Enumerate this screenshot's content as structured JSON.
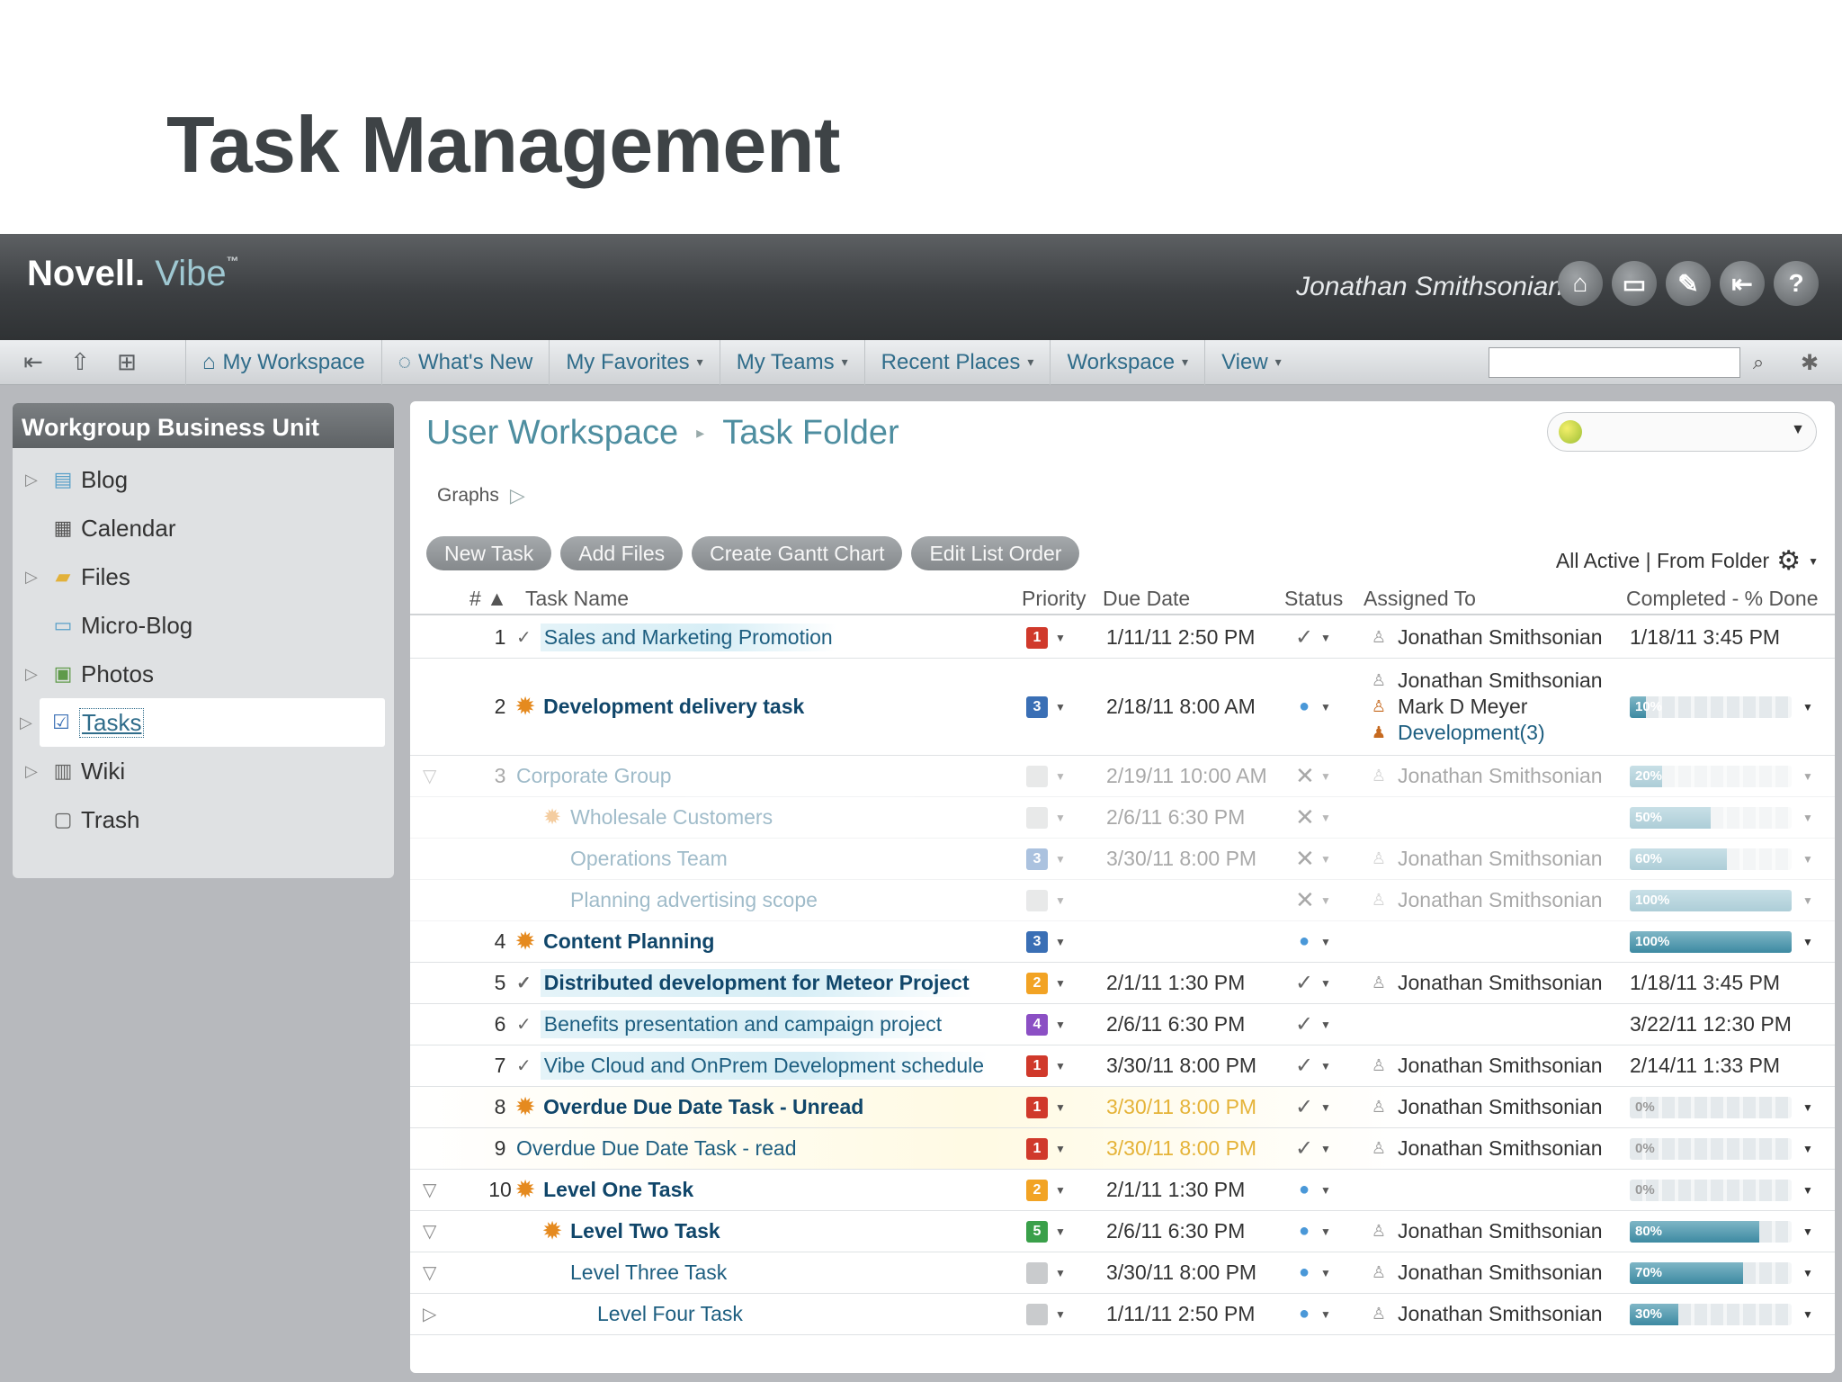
{
  "slide": {
    "title": "Task Management"
  },
  "header": {
    "brand": "Novell.",
    "product": "Vibe",
    "tm": "™",
    "user": "Jonathan Smithsonian",
    "icons": [
      "home-icon",
      "monitor-icon",
      "edit-icon",
      "logout-icon",
      "help-icon"
    ]
  },
  "nav": {
    "tool_icons": [
      "collapse-icon",
      "upload-icon",
      "tree-icon"
    ],
    "items": [
      {
        "label": "My Workspace",
        "icon": "workspace-icon",
        "arrow": false
      },
      {
        "label": "What's New",
        "icon": "whats-new-icon",
        "arrow": false
      },
      {
        "label": "My Favorites",
        "arrow": true
      },
      {
        "label": "My Teams",
        "arrow": true
      },
      {
        "label": "Recent Places",
        "arrow": true
      },
      {
        "label": "Workspace",
        "arrow": true
      },
      {
        "label": "View",
        "arrow": true
      }
    ],
    "search_value": ""
  },
  "sidebar": {
    "title": "Workgroup Business Unit",
    "items": [
      {
        "label": "Blog",
        "icon": "blog-icon",
        "expandable": true
      },
      {
        "label": "Calendar",
        "icon": "calendar-icon",
        "expandable": false
      },
      {
        "label": "Files",
        "icon": "folder-icon",
        "expandable": true
      },
      {
        "label": "Micro-Blog",
        "icon": "micro-blog-icon",
        "expandable": false
      },
      {
        "label": "Photos",
        "icon": "photos-icon",
        "expandable": true
      },
      {
        "label": "Tasks",
        "icon": "tasks-icon",
        "expandable": true,
        "active": true
      },
      {
        "label": "Wiki",
        "icon": "wiki-icon",
        "expandable": true
      },
      {
        "label": "Trash",
        "icon": "trash-icon",
        "expandable": false
      }
    ]
  },
  "main": {
    "breadcrumb": [
      "User Workspace",
      "Task Folder"
    ],
    "graphs_label": "Graphs",
    "buttons": [
      "New Task",
      "Add Files",
      "Create Gantt Chart",
      "Edit List Order"
    ],
    "filter_label": "All Active | From Folder",
    "columns": {
      "num": "# ▲",
      "name": "Task Name",
      "priority": "Priority",
      "due": "Due Date",
      "status": "Status",
      "assigned": "Assigned To",
      "completed": "Completed - % Done"
    },
    "colors": {
      "accent": "#4e8ea0",
      "link": "#1d5e80",
      "overdue": "#e5b338",
      "priority_1": "#d0392b",
      "priority_2": "#f2a324",
      "priority_3": "#3a6fb5",
      "priority_4": "#8b4fc4",
      "priority_5": "#3aa04a"
    },
    "rows": [
      {
        "num": "1",
        "name": "Sales and Marketing Promotion",
        "state": "check",
        "bold": false,
        "indent": 0,
        "toggle": "",
        "priority": "1",
        "due": "1/11/11 2:50 PM",
        "status": "check",
        "assigned": [
          {
            "name": "Jonathan Smithsonian",
            "type": "person"
          }
        ],
        "completed": "1/18/11 3:45 PM",
        "highlight": true
      },
      {
        "num": "2",
        "name": "Development delivery task",
        "state": "sun",
        "bold": true,
        "indent": 0,
        "toggle": "",
        "priority": "3",
        "due": "2/18/11 8:00 AM",
        "status": "progress",
        "assigned": [
          {
            "name": "Jonathan Smithsonian",
            "type": "person"
          },
          {
            "name": "Mark D Meyer",
            "type": "person2"
          },
          {
            "name": "Development(3)",
            "type": "group"
          }
        ],
        "percent": 10,
        "percent_label": "10%",
        "tall": true
      },
      {
        "num": "3",
        "name": "Corporate Group",
        "state": "",
        "bold": false,
        "indent": 0,
        "toggle": "open",
        "priority": "",
        "due": "2/19/11 10:00 AM",
        "status": "x",
        "assigned": [
          {
            "name": "Jonathan Smithsonian",
            "type": "person"
          }
        ],
        "percent": 20,
        "percent_label": "20%",
        "dim": true
      },
      {
        "num": "",
        "name": "Wholesale Customers",
        "state": "sun",
        "bold": false,
        "indent": 1,
        "toggle": "",
        "priority": "",
        "due": "2/6/11 6:30 PM",
        "status": "x",
        "assigned": [],
        "percent": 50,
        "percent_label": "50%",
        "dim": true
      },
      {
        "num": "",
        "name": "Operations Team",
        "state": "",
        "bold": false,
        "indent": 2,
        "toggle": "",
        "priority": "3",
        "due": "3/30/11 8:00 PM",
        "status": "x",
        "assigned": [
          {
            "name": "Jonathan Smithsonian",
            "type": "person"
          }
        ],
        "percent": 60,
        "percent_label": "60%",
        "dim": true
      },
      {
        "num": "",
        "name": "Planning advertising scope",
        "state": "",
        "bold": false,
        "indent": 2,
        "toggle": "",
        "priority": "",
        "due": "",
        "status": "x",
        "assigned": [
          {
            "name": "Jonathan Smithsonian",
            "type": "person"
          }
        ],
        "percent": 100,
        "percent_label": "100%",
        "dim": true
      },
      {
        "num": "4",
        "name": "Content Planning",
        "state": "sun",
        "bold": true,
        "indent": 0,
        "toggle": "",
        "priority": "3",
        "due": "",
        "status": "progress",
        "assigned": [],
        "percent": 100,
        "percent_label": "100%"
      },
      {
        "num": "5",
        "name": "Distributed development for Meteor Project",
        "state": "check",
        "bold": true,
        "indent": 0,
        "toggle": "",
        "priority": "2",
        "due": "2/1/11 1:30 PM",
        "status": "check",
        "assigned": [
          {
            "name": "Jonathan Smithsonian",
            "type": "person"
          }
        ],
        "completed": "1/18/11 3:45 PM",
        "highlight": true
      },
      {
        "num": "6",
        "name": "Benefits presentation and campaign project",
        "state": "check",
        "bold": false,
        "indent": 0,
        "toggle": "",
        "priority": "4",
        "due": "2/6/11 6:30 PM",
        "status": "check",
        "assigned": [],
        "completed": "3/22/11 12:30 PM",
        "highlight": true
      },
      {
        "num": "7",
        "name": "Vibe Cloud and OnPrem Development schedule",
        "state": "check",
        "bold": false,
        "indent": 0,
        "toggle": "",
        "priority": "1",
        "due": "3/30/11 8:00 PM",
        "status": "check",
        "assigned": [
          {
            "name": "Jonathan Smithsonian",
            "type": "person"
          }
        ],
        "completed": "2/14/11 1:33 PM",
        "highlight": true
      },
      {
        "num": "8",
        "name": "Overdue Due Date Task - Unread",
        "state": "sun",
        "bold": true,
        "indent": 0,
        "toggle": "",
        "priority": "1",
        "due": "3/30/11 8:00 PM",
        "late": true,
        "status": "check",
        "assigned": [
          {
            "name": "Jonathan Smithsonian",
            "type": "person"
          }
        ],
        "percent": 0,
        "percent_label": "0%",
        "overdue": true
      },
      {
        "num": "9",
        "name": "Overdue Due Date Task - read",
        "state": "",
        "bold": false,
        "indent": 0,
        "toggle": "",
        "priority": "1",
        "due": "3/30/11 8:00 PM",
        "late": true,
        "status": "check",
        "assigned": [
          {
            "name": "Jonathan Smithsonian",
            "type": "person"
          }
        ],
        "percent": 0,
        "percent_label": "0%",
        "overdue": true
      },
      {
        "num": "10",
        "name": "Level One Task",
        "state": "sun",
        "bold": true,
        "indent": 0,
        "toggle": "open",
        "priority": "2",
        "due": "2/1/11 1:30 PM",
        "status": "progress",
        "assigned": [],
        "percent": 0,
        "percent_label": "0%"
      },
      {
        "num": "",
        "name": "Level Two Task",
        "state": "sun",
        "bold": true,
        "indent": 1,
        "toggle": "open",
        "priority": "5",
        "due": "2/6/11 6:30 PM",
        "status": "progress",
        "assigned": [
          {
            "name": "Jonathan Smithsonian",
            "type": "person"
          }
        ],
        "percent": 80,
        "percent_label": "80%"
      },
      {
        "num": "",
        "name": "Level Three Task",
        "state": "",
        "bold": false,
        "indent": 2,
        "toggle": "open",
        "priority": "",
        "due": "3/30/11 8:00 PM",
        "status": "progress",
        "assigned": [
          {
            "name": "Jonathan Smithsonian",
            "type": "person"
          }
        ],
        "percent": 70,
        "percent_label": "70%"
      },
      {
        "num": "",
        "name": "Level Four Task",
        "state": "",
        "bold": false,
        "indent": 3,
        "toggle": "closed",
        "priority": "",
        "due": "1/11/11 2:50 PM",
        "status": "progress",
        "assigned": [
          {
            "name": "Jonathan Smithsonian",
            "type": "person"
          }
        ],
        "percent": 30,
        "percent_label": "30%"
      }
    ]
  }
}
